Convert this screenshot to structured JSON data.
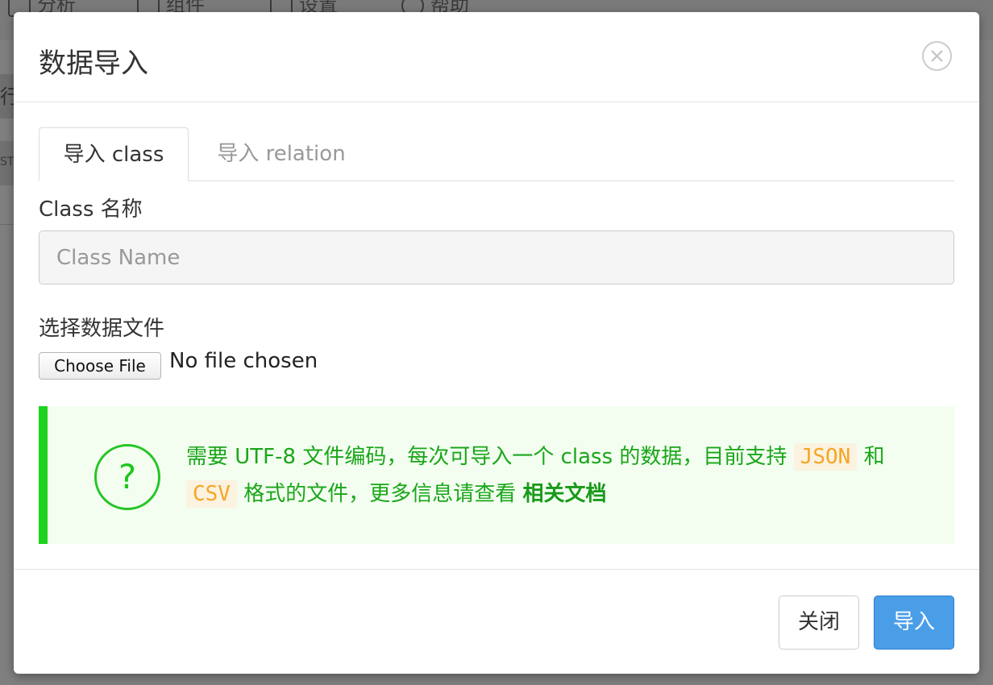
{
  "background_nav": {
    "items": [
      {
        "label": "分析"
      },
      {
        "label": "组件"
      },
      {
        "label": "设置"
      },
      {
        "label": "帮助"
      }
    ],
    "row_fragment": "行",
    "row_fragment2": "ST"
  },
  "modal": {
    "title": "数据导入",
    "close_icon": "close-icon",
    "tabs": [
      {
        "label": "导入 class",
        "active": true
      },
      {
        "label": "导入 relation",
        "active": false
      }
    ],
    "class_name": {
      "label": "Class 名称",
      "placeholder": "Class Name",
      "value": ""
    },
    "file": {
      "label": "选择数据文件",
      "button_label": "Choose File",
      "status": "No file chosen"
    },
    "notice": {
      "icon": "question-icon",
      "text_part1": "需要 UTF-8 文件编码，每次可导入一个 class 的数据，目前支持",
      "code1": "JSON",
      "text_part2": "和",
      "code2": "CSV",
      "text_part3": "格式的文件，更多信息请查看",
      "link_label": "相关文档"
    },
    "footer": {
      "close_label": "关闭",
      "import_label": "导入"
    }
  },
  "colors": {
    "overlay": "#7f7f7f",
    "notice_border": "#1ed31e",
    "notice_text": "#1aa61a",
    "primary": "#4a9ee8",
    "code_text": "#f5a623"
  }
}
